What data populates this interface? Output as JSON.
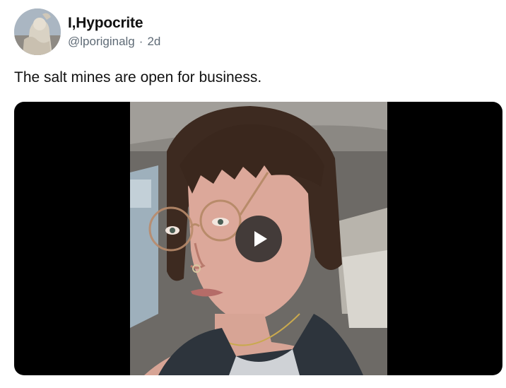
{
  "post": {
    "author": {
      "display_name": "I,Hypocrite",
      "handle": "@lporiginalg",
      "separator": "·",
      "time_ago": "2d",
      "avatar_icon": "statue-avatar"
    },
    "text": "The salt mines are open for business.",
    "media": {
      "type": "video",
      "play_icon": "play-icon"
    }
  }
}
